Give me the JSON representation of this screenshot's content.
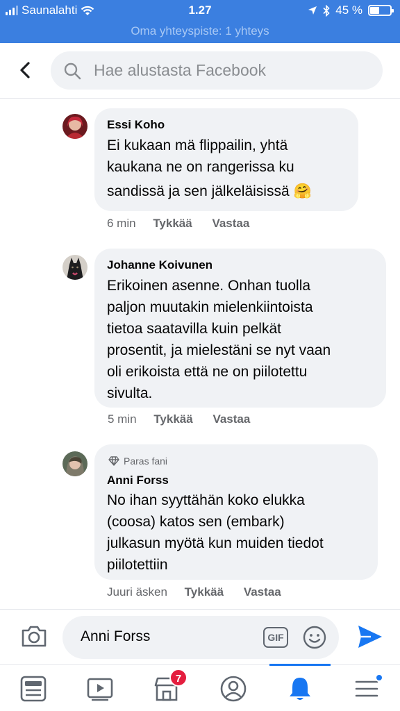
{
  "status_bar": {
    "carrier": "Saunalahti",
    "time": "1.27",
    "battery_text": "45 %",
    "battery_level": 0.45,
    "hotspot": "Oma yhteyspiste: 1 yhteys"
  },
  "header": {
    "search_placeholder": "Hae alustasta Facebook"
  },
  "comments": [
    {
      "name": "Essi Koho",
      "lines": [
        "Ei kukaan mä flippailin, yhtä",
        "kaukana ne on rangerissa ku",
        "sandissä ja sen jälkeläisissä 🤗"
      ],
      "time": "6 min",
      "like": "Tykkää",
      "reply": "Vastaa"
    },
    {
      "name": "Johanne Koivunen",
      "lines": [
        "Erikoinen asenne. Onhan tuolla",
        "paljon muutakin mielenkiintoista",
        "tietoa saatavilla kuin pelkät",
        "prosentit, ja mielestäni se nyt vaan",
        "oli erikoista että ne on piilotettu",
        "sivulta."
      ],
      "time": "5 min",
      "like": "Tykkää",
      "reply": "Vastaa"
    },
    {
      "badge": "Paras fani",
      "name": "Anni Forss",
      "lines": [
        "No ihan syyttähän koko elukka",
        "(coosa) katos sen (embark)",
        "julkasun myötä kun muiden tiedot",
        "piilotettiin"
      ],
      "time": "Juuri äsken",
      "like": "Tykkää",
      "reply": "Vastaa"
    }
  ],
  "composer": {
    "value": "Anni Forss",
    "gif_label": "GIF"
  },
  "tabbar": {
    "marketplace_badge": "7",
    "active_tab": "notifications"
  },
  "colors": {
    "status_bar": "#3b7fe0",
    "accent": "#1877f2",
    "badge": "#e41e3f",
    "bubble": "#f0f2f5"
  }
}
